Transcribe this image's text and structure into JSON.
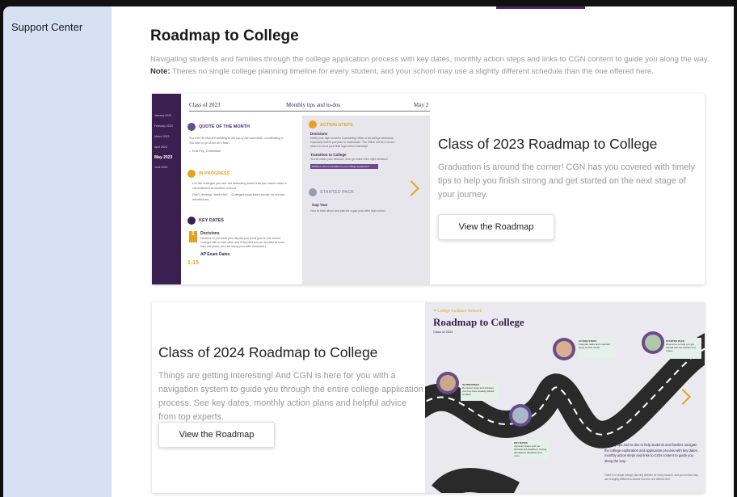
{
  "sidebar": {
    "items": [
      {
        "label": "Support Center"
      }
    ]
  },
  "main": {
    "title": "Roadmap to College",
    "intro_line": "Navigating students and families through the college application process with key dates, monthly action steps and links to CGN content to guide you along the way.",
    "note_label": "Note:",
    "note_text": "Theres no single college planning timeline for every student, and your school may use a slightly different schedule than the one offered here."
  },
  "cards": [
    {
      "title": "Class of 2023 Roadmap to College",
      "description": "Graduation is around the corner! CGN has you covered with timely tips to help you finish strong and get started on the next stage of your journey.",
      "button": "View the Roadmap",
      "thumbnail": {
        "header_left": "Class of 2023",
        "header_mid": "Monthly tips and to-dos",
        "header_right": "May 2",
        "sidebar_months": [
          "January 2023",
          "February 2023",
          "March 2023",
          "April 2023",
          "May 2023",
          "June 2023"
        ],
        "quote_head": "QUOTE OF THE MONTH",
        "quote_text": "You can't be that kid standing at the top of the waterslide, overthinking it. You have to go down the chute.",
        "quote_author": "– Tina Fey, Comedian",
        "progress_head": "IN PROGRESS",
        "progress_items": [
          "Let the colleges you are not attending know that you have made a commitment at another school.",
          "Don't develop \"senioritis\" – Colleges have been known to revoke admissions."
        ],
        "keydates_head": "KEY DATES",
        "date1_num": "1",
        "date1_title": "Decisions",
        "date1_text": "Deadline to put down your deposit and enroll (just to one school. Colleges talk to each other and if they find out you enrolled at more than one place, you risk losing your offer rescinded.)",
        "date2_num": "1-15",
        "date2_title": "AP Exam Dates",
        "action_head": "ACTION STEPS",
        "action1_title": "Decisions",
        "action1_text": "Notify your high school's Counseling Office of all college decisions, especially where you plan to matriculate. The Office needs to know where to send your final high school transcript.",
        "action2_title": "Transition to College",
        "action2_text": "You've made your decision, then go make it the right decision!",
        "action2_link": "WATCH: How to transition to your college experience",
        "starter_head": "STARTED PACK",
        "starter_title": "Gap Year",
        "starter_text": "How to think about and plan for a gap year after high school."
      }
    },
    {
      "title": "Class of 2024 Roadmap to College",
      "description": "Things are getting interesting! And CGN is here for you with a navigation system to guide you through the entire college application process. See key dates, monthly action plans and helpful advice from top experts.",
      "button": "View the Roadmap",
      "thumbnail": {
        "brand": "College Guidance Network",
        "title": "Roadmap to College",
        "subtitle": "Class of 2024",
        "pin_labels": [
          "IN PROGRESS",
          "KEY DATES",
          "ACTION STEPS",
          "STARTER PACK"
        ],
        "pin_texts": [
          "Reminder tasks and activities you may have already started or taken.",
          "Important dates such as financial aid deadlines, testing, admissions deadlines and more.",
          "Calendar tasks and important steps for this month.",
          "Resources to help you get started with the articles and videos."
        ],
        "caption": "Monthly tips and to-dos to help students and families navigate the college exploration and application process with key dates, monthly action steps and links to CGN content to guide you along the way.",
        "caption_small": "There's no single college planning timeline for every student, and your school may use a slightly different schedule than the one offered here."
      }
    }
  ],
  "colors": {
    "sidebar_bg": "#d6e2f4",
    "accent_purple": "#4b2a6b",
    "accent_orange": "#e8a020",
    "muted_text": "#9a9a9a"
  }
}
